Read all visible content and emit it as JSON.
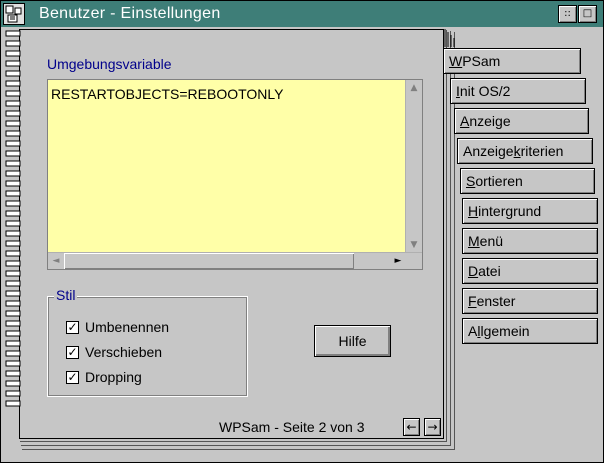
{
  "window": {
    "title": "Benutzer - Einstellungen",
    "restore_glyph": "::",
    "close_glyph": "□"
  },
  "env": {
    "label": "Umgebungsvariable",
    "value": "RESTARTOBJECTS=REBOOTONLY"
  },
  "stil": {
    "label": "Stil",
    "checkboxes": [
      {
        "label": "Umbenennen",
        "checked": true
      },
      {
        "label": "Verschieben",
        "checked": true
      },
      {
        "label": "Dropping",
        "checked": true
      }
    ]
  },
  "buttons": {
    "help": "Hilfe"
  },
  "status": {
    "page_text": "WPSam - Seite 2 von 3",
    "prev": "←",
    "next": "→"
  },
  "tabs": [
    {
      "label": "WPSam",
      "accel": "W",
      "rest": "PSam",
      "active": true
    },
    {
      "label": "Init OS/2",
      "accel": "I",
      "rest": "nit OS/2",
      "active": false
    },
    {
      "label": "Anzeige",
      "accel": "A",
      "rest": "nzeige",
      "active": false
    },
    {
      "label": "Anzeigekriterien",
      "pre": "Anzeige",
      "accel": "k",
      "rest": "riterien",
      "active": false
    },
    {
      "label": "Sortieren",
      "accel": "S",
      "rest": "ortieren",
      "active": false
    },
    {
      "label": "Hintergrund",
      "accel": "H",
      "rest": "intergrund",
      "active": false
    },
    {
      "label": "Menü",
      "accel": "M",
      "rest": "enü",
      "active": false
    },
    {
      "label": "Datei",
      "accel": "D",
      "rest": "atei",
      "active": false
    },
    {
      "label": "Fenster",
      "accel": "F",
      "rest": "enster",
      "active": false
    },
    {
      "label": "Allgemein",
      "pre": "A",
      "accel": "l",
      "rest": "lgemein",
      "active": false
    }
  ],
  "scroll": {
    "up": "▲",
    "down": "▼",
    "left": "◄",
    "right": "►"
  },
  "icons": [
    "system-menu-icon",
    "restore-icon",
    "close-icon",
    "arrow-left-icon",
    "arrow-right-icon",
    "check-icon",
    "spiral-binding-icon"
  ],
  "colors": {
    "titlebar": "#3e7e78",
    "text_area_bg": "#ffffa8",
    "group_label": "#00008b",
    "window_bg": "#c6c6c6"
  }
}
